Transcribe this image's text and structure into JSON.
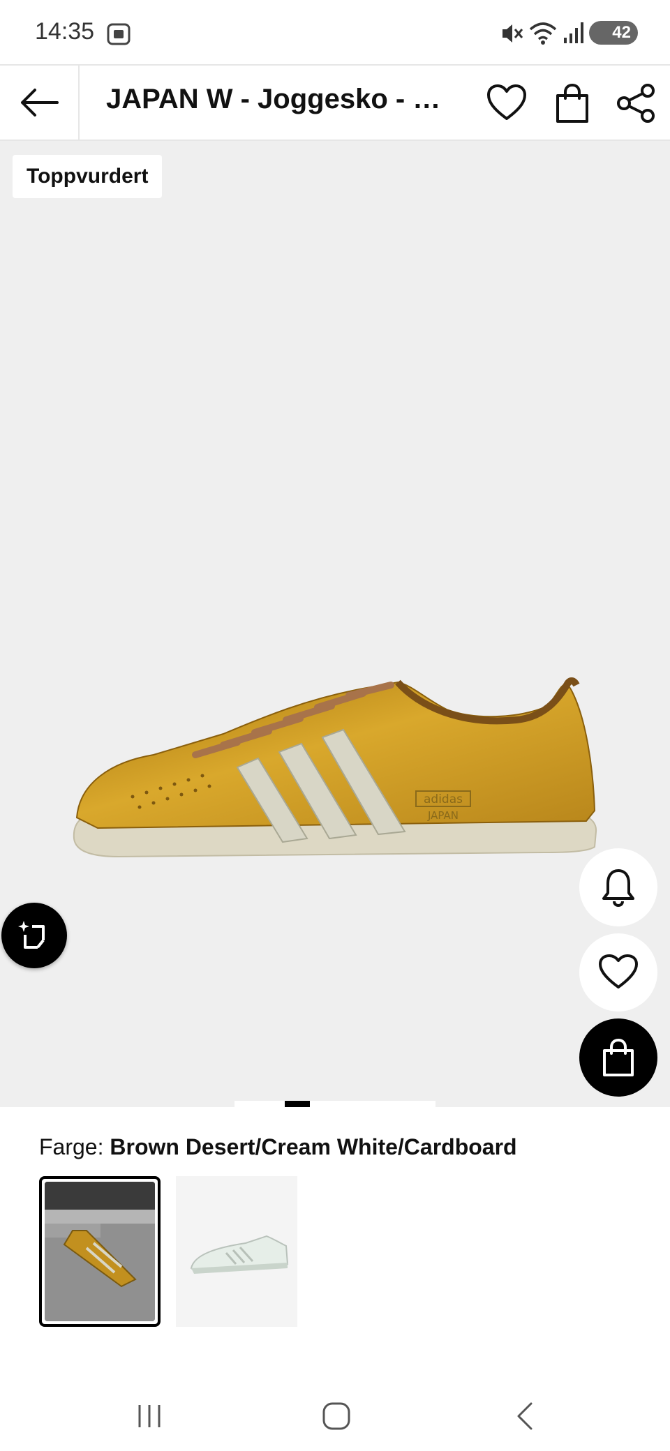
{
  "status_bar": {
    "time": "14:35",
    "battery": "42",
    "icons": [
      "screenshot-icon",
      "mute-icon",
      "wifi-icon",
      "signal-icon",
      "battery-icon"
    ]
  },
  "app_bar": {
    "title": "JAPAN W - Joggesko - brown desert/cream white/cardboard",
    "icons": [
      "back-arrow-icon",
      "heart-icon",
      "shopping-bag-icon",
      "share-icon"
    ]
  },
  "hero": {
    "badge": "Toppvurdert",
    "shoe_logo_line1": "adidas",
    "shoe_logo_line2": "JAPAN",
    "image_count": 4,
    "active_image": 2,
    "colors": {
      "background": "#efefef",
      "shoe": "#c9951e",
      "stripes": "#d8d6c6"
    }
  },
  "color": {
    "label": "Farge:",
    "value": "Brown Desert/Cream White/Cardboard"
  },
  "swatches": [
    {
      "name": "gold",
      "selected": true
    },
    {
      "name": "white",
      "selected": false
    }
  ],
  "nav_bar": {
    "icons": [
      "recent-apps-icon",
      "home-icon",
      "back-icon"
    ]
  }
}
